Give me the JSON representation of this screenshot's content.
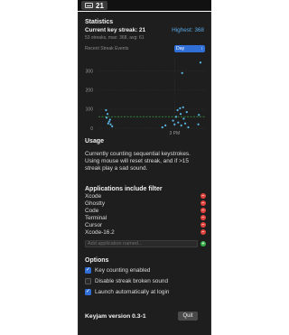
{
  "menubar": {
    "status_count": "21",
    "icon": "keyboard-icon"
  },
  "statistics": {
    "heading": "Statistics",
    "current_streak": "Current key streak: 21",
    "highest": "Highest: 368",
    "summary": "53 streaks, max: 368, avg: 61",
    "recent_label": "Recent Streak Events",
    "range_selected": "Day"
  },
  "chart_data": {
    "type": "scatter",
    "title": "Recent Streak Events",
    "yticks": [
      "300",
      "200",
      "100",
      "0"
    ],
    "xticks": [
      "3 PM"
    ],
    "ylim": [
      0,
      370
    ],
    "x_domain_hours": [
      12.5,
      16
    ],
    "reference_line": {
      "value": 61,
      "color": "#3fbf4a",
      "label": ""
    },
    "grid": true,
    "series": [
      {
        "color": "#5ab8e8",
        "points": [
          {
            "x": 12.75,
            "y": 95
          },
          {
            "x": 12.8,
            "y": 75
          },
          {
            "x": 12.77,
            "y": 55
          },
          {
            "x": 12.85,
            "y": 35
          },
          {
            "x": 12.9,
            "y": 20
          },
          {
            "x": 12.95,
            "y": 10
          },
          {
            "x": 12.82,
            "y": 25
          },
          {
            "x": 12.88,
            "y": 45
          },
          {
            "x": 14.6,
            "y": 5
          },
          {
            "x": 14.7,
            "y": 15
          },
          {
            "x": 14.95,
            "y": 40
          },
          {
            "x": 15.0,
            "y": 20
          },
          {
            "x": 15.05,
            "y": 60
          },
          {
            "x": 15.1,
            "y": 95
          },
          {
            "x": 15.12,
            "y": 30
          },
          {
            "x": 15.18,
            "y": 105
          },
          {
            "x": 15.2,
            "y": 75
          },
          {
            "x": 15.22,
            "y": 15
          },
          {
            "x": 15.28,
            "y": 110
          },
          {
            "x": 15.3,
            "y": 50
          },
          {
            "x": 15.35,
            "y": 25
          },
          {
            "x": 15.4,
            "y": 85
          },
          {
            "x": 15.45,
            "y": 5
          },
          {
            "x": 15.25,
            "y": 290
          },
          {
            "x": 15.85,
            "y": 345
          },
          {
            "x": 15.8,
            "y": 70
          },
          {
            "x": 15.78,
            "y": 20
          }
        ]
      }
    ]
  },
  "usage": {
    "heading": "Usage",
    "lines": [
      "Currently counting sequential keystrokes.",
      "Using mouse will reset streak, and if >15",
      "streak play a sad sound."
    ]
  },
  "apps": {
    "heading": "Applications include filter",
    "items": [
      "Xcode",
      "Ghostty",
      "Code",
      "Terminal",
      "Cursor",
      "Xcode-16.2"
    ],
    "add_placeholder": "Add application named...",
    "remove_icon": "remove-icon",
    "add_icon": "add-icon"
  },
  "options": {
    "heading": "Options",
    "items": [
      {
        "label": "Key counting enabled",
        "checked": true
      },
      {
        "label": "Disable streak broken sound",
        "checked": false
      },
      {
        "label": "Launch automatically at login",
        "checked": true
      }
    ]
  },
  "footer": {
    "version": "Keyjam version 0.3-1",
    "quit": "Quit"
  }
}
